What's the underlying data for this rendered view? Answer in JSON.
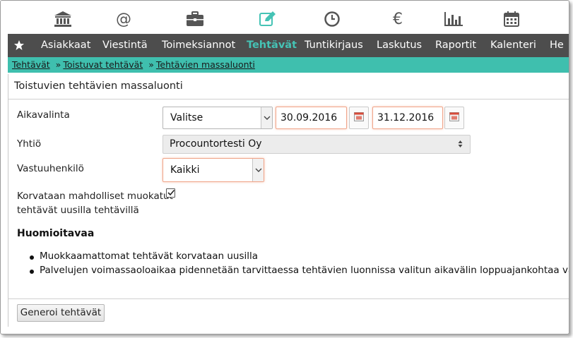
{
  "icons": [
    "bank-icon",
    "at-icon",
    "briefcase-icon",
    "edit-icon",
    "clock-icon",
    "euro-icon",
    "bar-chart-icon",
    "calendar-icon"
  ],
  "nav": {
    "star_icon": "star-icon",
    "items": [
      "Asiakkaat",
      "Viestintä",
      "Toimeksiannot",
      "Tehtävät",
      "Tuntikirjaus",
      "Laskutus",
      "Raportit",
      "Kalenteri",
      "He"
    ],
    "active": "Tehtävät"
  },
  "breadcrumb": {
    "items": [
      "Tehtävät",
      "Toistuvat tehtävät",
      "Tehtävien massaluonti"
    ],
    "separator": "»"
  },
  "page": {
    "title": "Toistuvien tehtävien massaluonti"
  },
  "form": {
    "time_label": "Aikavalinta",
    "time_select": "Valitse",
    "date_from": "30.09.2016",
    "date_to": "31.12.2016",
    "company_label": "Yhtiö",
    "company_value": "Procountortesti Oy",
    "owner_label": "Vastuuhenkilö",
    "owner_value": "Kaikki",
    "overwrite_label_line1": "Korvataan mahdolliset muokatut",
    "overwrite_label_line2": "tehtävät uusilla tehtävillä",
    "overwrite_checked": true
  },
  "notes": {
    "heading": "Huomioitavaa",
    "items": [
      "Muokkaamattomat tehtävät korvataan uusilla",
      "Palvelujen voimassaoloaikaa pidennetään tarvittaessa tehtävien luonnissa valitun aikavälin loppuajankohtaa vastaavaksi"
    ]
  },
  "actions": {
    "generate_label": "Generoi tehtävät"
  },
  "colors": {
    "nav_bg": "#4d4d4d",
    "accent": "#45c3b5",
    "breadcrumb_bg": "#3fbfae",
    "focus_border": "#f0a58a"
  }
}
